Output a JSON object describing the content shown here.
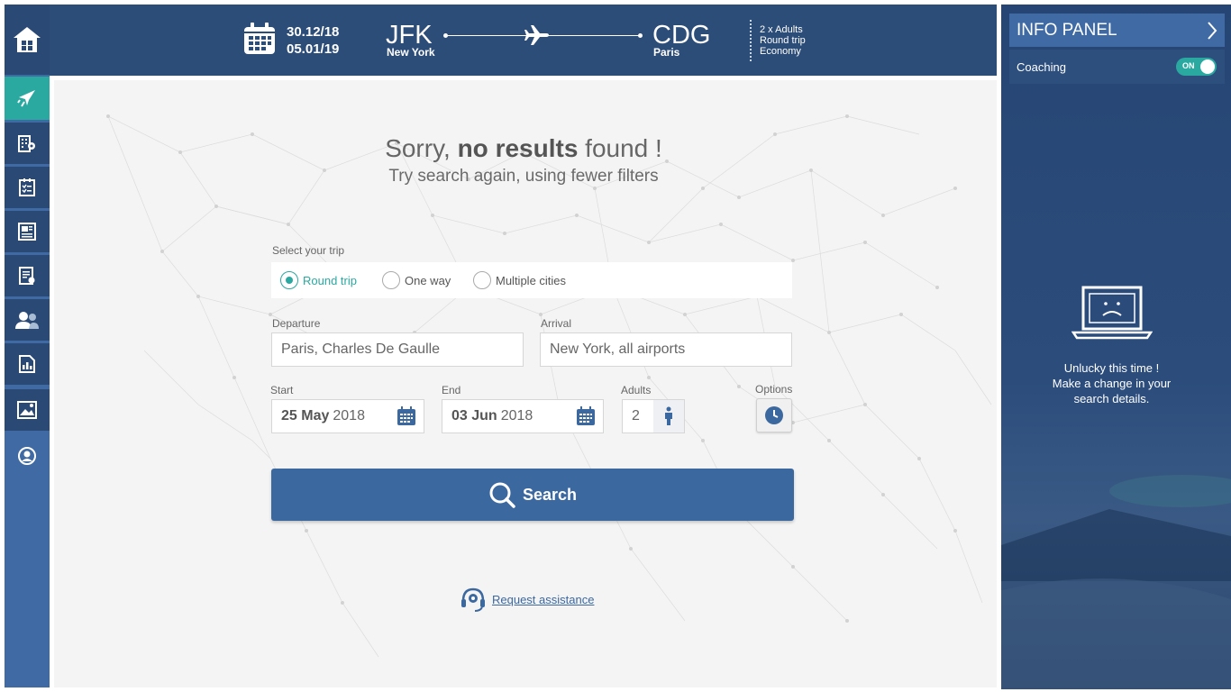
{
  "header": {
    "date_out": "30.12/18",
    "date_back": "05.01/19",
    "origin_code": "JFK",
    "origin_city": "New York",
    "dest_code": "CDG",
    "dest_city": "Paris",
    "passengers": "2 x Adults",
    "trip_type": "Round trip",
    "cabin": "Economy"
  },
  "sidebar": {
    "items": [
      "home-icon",
      "plane-icon",
      "hotel-icon",
      "checklist-icon",
      "newspaper-icon",
      "report-icon",
      "users-icon",
      "analytics-icon",
      "gallery-icon",
      "profile-icon"
    ],
    "colors": {
      "bar": "#3f6aa3",
      "dark": "#2a4a75",
      "active": "#2aa9a1"
    }
  },
  "message": {
    "sorry_prefix": "Sorry,",
    "sorry_bold": "no results",
    "sorry_suffix": "found !",
    "subtitle": "Try search again, using fewer filters"
  },
  "form": {
    "select_trip_label": "Select your trip",
    "trip_options": [
      "Round trip",
      "One way",
      "Multiple cities"
    ],
    "selected_trip": "Round trip",
    "departure_label": "Departure",
    "departure_value": "Paris, Charles De Gaulle",
    "arrival_label": "Arrival",
    "arrival_value": "New York, all airports",
    "start_label": "Start",
    "start_day": "25 May",
    "start_year": "2018",
    "end_label": "End",
    "end_day": "03 Jun",
    "end_year": "2018",
    "adults_label": "Adults",
    "adults_value": "2",
    "options_label": "Options",
    "search_label": "Search",
    "assist_label": "Request assistance"
  },
  "panel": {
    "title": "INFO PANEL",
    "coaching_label": "Coaching",
    "toggle_label": "ON",
    "msg_line1": "Unlucky this time !",
    "msg_line2": "Make a change in your",
    "msg_line3": "search details."
  }
}
